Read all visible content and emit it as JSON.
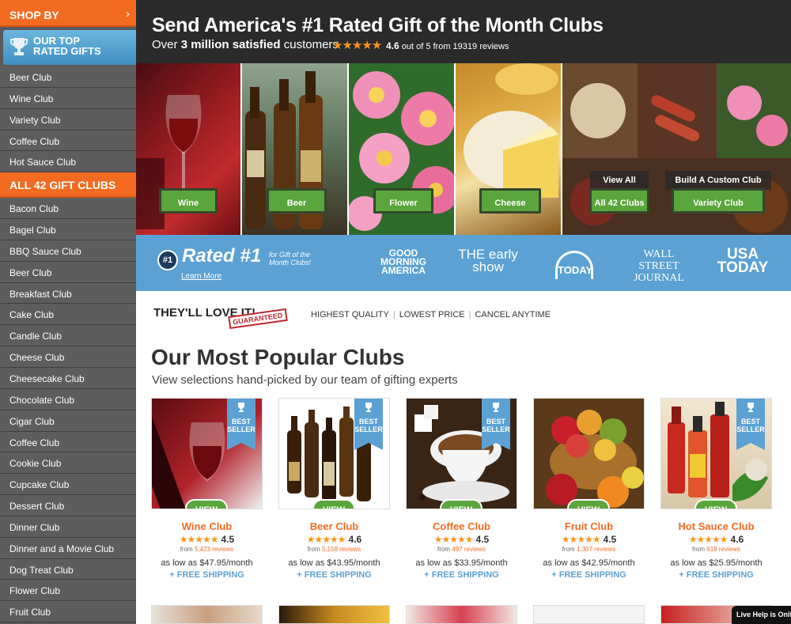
{
  "sidebar": {
    "shop_by": "SHOP BY",
    "top_rated": [
      "OUR TOP",
      "RATED GIFTS"
    ],
    "top_items": [
      "Beer Club",
      "Wine Club",
      "Variety Club",
      "Coffee Club",
      "Hot Sauce Club"
    ],
    "all_clubs": "ALL 42 GIFT CLUBS",
    "clubs": [
      "Bacon Club",
      "Bagel Club",
      "BBQ Sauce Club",
      "Beer Club",
      "Breakfast Club",
      "Cake Club",
      "Candle Club",
      "Cheese Club",
      "Cheesecake Club",
      "Chocolate Club",
      "Cigar Club",
      "Coffee Club",
      "Cookie Club",
      "Cupcake Club",
      "Dessert Club",
      "Dinner Club",
      "Dinner and a Movie Club",
      "Dog Treat Club",
      "Flower Club",
      "Fruit Club"
    ]
  },
  "hero": {
    "title": "Send America's #1 Rated Gift of the Month Clubs",
    "sub_prefix": "Over ",
    "sub_bold": "3 million satisfied",
    "sub_suffix": " customers",
    "stars": "★★★★★",
    "rating": "4.6",
    "rating_rest": " out of 5 from 19319 reviews"
  },
  "tiles": {
    "wine": "Wine",
    "beer": "Beer",
    "flower": "Flower",
    "cheese": "Cheese",
    "view_all_label": "View All",
    "view_all_btn": "All 42 Clubs",
    "custom_label": "Build A Custom Club",
    "custom_btn": "Variety Club"
  },
  "banner": {
    "badge": "#1",
    "rated": "Rated #1",
    "small": [
      "for Gift of the",
      "Month Clubs!"
    ],
    "learn_more": "Learn More",
    "media": [
      "GOOD MORNING AMERICA",
      "THE early show",
      "TODAY",
      "WALL STREET JOURNAL",
      "USA TODAY"
    ]
  },
  "guarantee": {
    "love": "THEY'LL LOVE IT!",
    "stamp": "GUARANTEED",
    "qualities": [
      "HIGHEST QUALITY",
      "LOWEST PRICE",
      "CANCEL ANYTIME"
    ]
  },
  "popular": {
    "title": "Our Most Popular Clubs",
    "subtitle": "View selections hand-picked by our team of gifting experts",
    "badge_text": [
      "BEST",
      "SELLER"
    ],
    "view": "VIEW",
    "ship": "+ FREE SHIPPING",
    "from_prefix": "from ",
    "products": [
      {
        "name": "Wine Club",
        "rating": "4.5",
        "reviews": "5,423 reviews",
        "price": "as low as $47.95/month"
      },
      {
        "name": "Beer Club",
        "rating": "4.6",
        "reviews": "5,158 reviews",
        "price": "as low as $43.95/month"
      },
      {
        "name": "Coffee Club",
        "rating": "4.5",
        "reviews": "497 reviews",
        "price": "as low as $33.95/month"
      },
      {
        "name": "Fruit Club",
        "rating": "4.5",
        "reviews": "1,307 reviews",
        "price": "as low as $42.95/month"
      },
      {
        "name": "Hot Sauce Club",
        "rating": "4.6",
        "reviews": "619 reviews",
        "price": "as low as $25.95/month"
      }
    ],
    "stars": "★★★★★"
  },
  "live_help": "Live Help is Online",
  "colors": {
    "orange": "#f26b21",
    "blue": "#5ba1d3",
    "green": "#5aa53c",
    "sidebar": "#5a5a5a"
  }
}
